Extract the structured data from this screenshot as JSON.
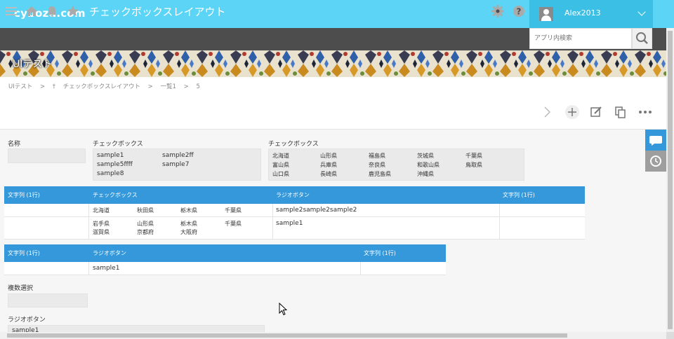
{
  "header": {
    "logo": "cybozu.com",
    "user_name": "Alex2013"
  },
  "navbar": {
    "title": "チェックボックスレイアウト",
    "search_placeholder": "アプリ内検索"
  },
  "banner": {
    "title": "UIテスト"
  },
  "breadcrumb": [
    "UIテスト",
    ">",
    "チェックボックスレイアウト",
    ">",
    "一覧1",
    ">",
    "5"
  ],
  "form": {
    "name_label": "名称",
    "checkbox1": {
      "label": "チェックボックス",
      "options": [
        "sample1",
        "sample2ff",
        "sample5ffff",
        "sample7",
        "sample8"
      ]
    },
    "checkbox2": {
      "label": "チェックボックス",
      "options": [
        "北海道",
        "山形県",
        "福島県",
        "茨城県",
        "千葉県",
        "富山県",
        "兵庫県",
        "奈良県",
        "和歌山県",
        "鳥取県",
        "山口県",
        "長崎県",
        "鹿児島県",
        "沖縄県"
      ]
    },
    "table1": {
      "headers": [
        "文字列 (1行)",
        "チェックボックス",
        "ラジオボタン",
        "文字列 (1行)"
      ],
      "rows": [
        {
          "checkboxes": [
            "北海道",
            "秋田県",
            "栃木県",
            "千葉県"
          ],
          "radio": "sample2sample2sample2"
        },
        {
          "checkboxes": [
            "岩手県",
            "山形県",
            "栃木県",
            "千葉県",
            "滋賀県",
            "京都府",
            "大阪府"
          ],
          "radio": "sample1"
        }
      ]
    },
    "table2": {
      "headers": [
        "文字列 (1行)",
        "ラジオボタン",
        "文字列 (1行)"
      ],
      "rows": [
        {
          "radio": "sample1"
        }
      ]
    },
    "multi_select_label": "複数選択",
    "radio_label": "ラジオボタン",
    "radio_value": "sample1"
  },
  "colors": {
    "header_bg": "#5bd4f6",
    "user_bg": "#3cbfe5",
    "nav_bg": "#4d4d4d",
    "table_header": "#3498db",
    "side_comment": "#3498db",
    "side_history": "#9e9e9e"
  },
  "icons": [
    "menu-icon",
    "home-icon",
    "bell-icon",
    "star-icon",
    "gear-icon",
    "help-icon",
    "search-icon",
    "chevron-right-icon",
    "plus-icon",
    "edit-icon",
    "copy-icon",
    "more-icon",
    "comment-icon",
    "history-icon",
    "pin-icon",
    "cursor-icon"
  ]
}
